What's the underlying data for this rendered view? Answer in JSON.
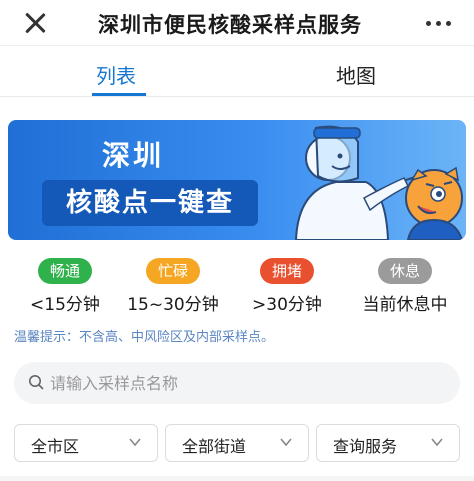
{
  "header": {
    "title": "深圳市便民核酸采样点服务",
    "close_icon": "close-icon",
    "more_icon": "more-icon"
  },
  "tabs": [
    {
      "label": "列表",
      "active": true
    },
    {
      "label": "地图",
      "active": false
    }
  ],
  "banner": {
    "title": "深圳",
    "subtitle": "核酸点一键查"
  },
  "legend": [
    {
      "badge": "畅通",
      "text": "<15分钟",
      "color": "#2fb24c"
    },
    {
      "badge": "忙碌",
      "text": "15~30分钟",
      "color": "#f5a623"
    },
    {
      "badge": "拥堵",
      "text": ">30分钟",
      "color": "#e8502f"
    },
    {
      "badge": "休息",
      "text": "当前休息中",
      "color": "#9b9b9b"
    }
  ],
  "tip": "温馨提示：不含高、中风险区及内部采样点。",
  "search": {
    "placeholder": "请输入采样点名称",
    "icon": "search-icon"
  },
  "filters": [
    {
      "label": "全市区",
      "icon": "chevron-down-icon"
    },
    {
      "label": "全部街道",
      "icon": "chevron-down-icon"
    },
    {
      "label": "查询服务",
      "icon": "chevron-down-icon"
    }
  ],
  "colors": {
    "accent": "#1677d2",
    "banner_dark": "#1458b8",
    "tip_text": "#5a86c2"
  }
}
